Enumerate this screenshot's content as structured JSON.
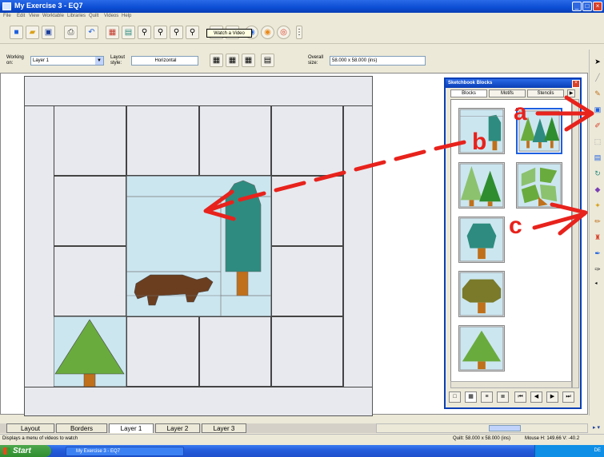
{
  "window": {
    "title": "My Exercise 3 - EQ7"
  },
  "menu": [
    "File",
    "Edit",
    "View",
    "Worktable",
    "Libraries",
    "Quilt",
    "Videos",
    "Help"
  ],
  "toolbar": {
    "tooltip": "Watch a Video"
  },
  "options": {
    "working_label": "Working on:",
    "working_value": "Layer 1",
    "layout_label": "Layout style:",
    "layout_value": "Horizontal",
    "overall_label": "Overall size:",
    "overall_value": "58.000 x 58.000 (ins)"
  },
  "panel": {
    "title": "Sketchbook Blocks",
    "tabs": [
      "Blocks",
      "Motifs",
      "Stencils"
    ],
    "active_tab": "Blocks"
  },
  "bottom_tabs": [
    "Layout",
    "Borders",
    "Layer 1",
    "Layer 2",
    "Layer 3"
  ],
  "active_bottom_tab": "Layer 1",
  "status": {
    "hint": "Displays a menu of videos to watch",
    "quilt": "Quilt: 58.000 x 58.000 (ins)",
    "mouse": "Mouse   H: 149.66   V: -40.2"
  },
  "taskbar": {
    "start": "Start",
    "item": "My Exercise 3 - EQ7",
    "tray": "DE"
  },
  "annotations": {
    "a": "a",
    "b": "b",
    "c": "c"
  },
  "colors": {
    "accent": "#e8221c",
    "sky": "#cce6f0",
    "tree": "#6aab3e",
    "trunk": "#c0701a",
    "bear": "#6b3e1f",
    "teal": "#2d8c7f"
  }
}
